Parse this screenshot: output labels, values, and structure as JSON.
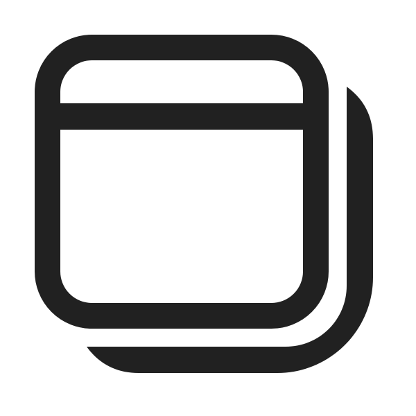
{
  "icon": {
    "name": "multiple-windows-icon",
    "stroke_color": "#212121",
    "background_color": "#ffffff"
  }
}
